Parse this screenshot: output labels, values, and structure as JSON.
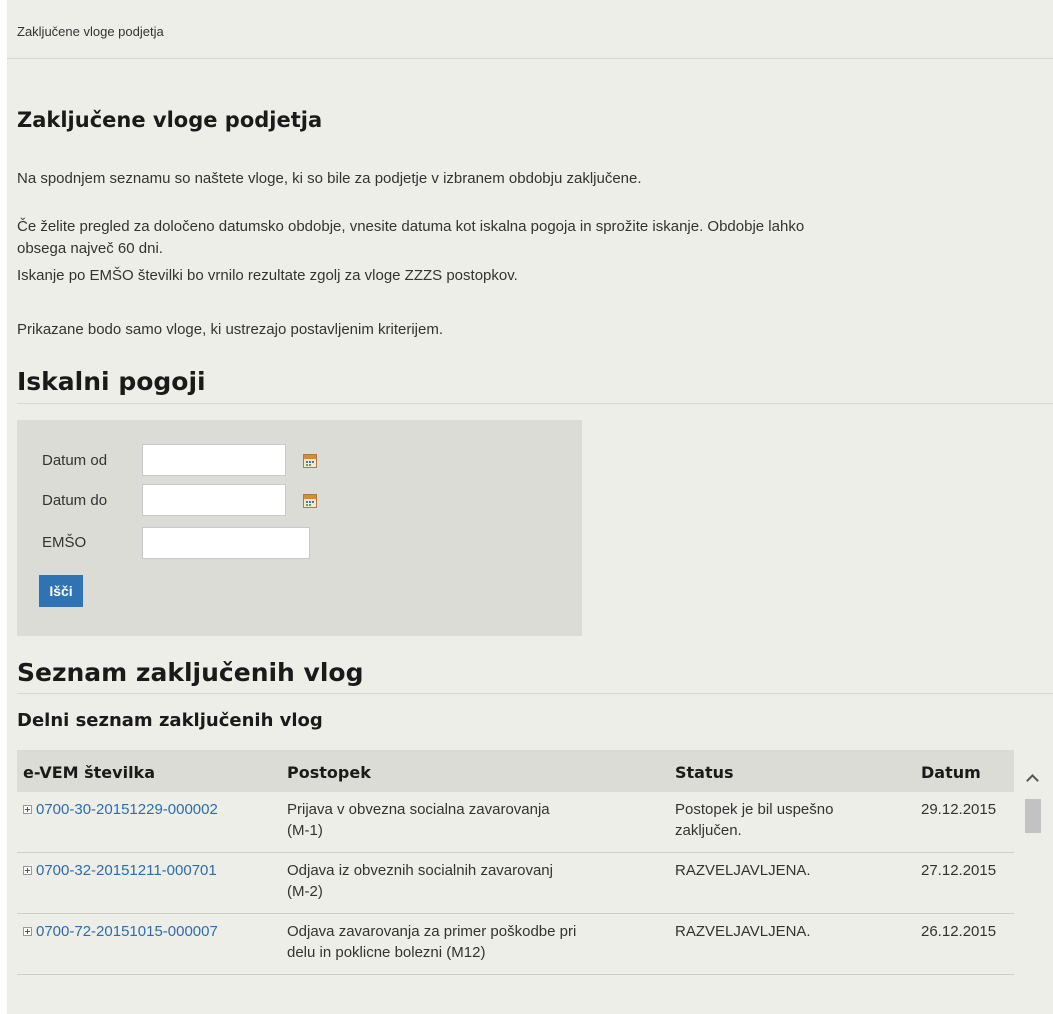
{
  "breadcrumb": "Zaključene vloge podjetja",
  "page_title": "Zaključene vloge podjetja",
  "intro": {
    "p1": "Na spodnjem seznamu so naštete vloge, ki so bile za podjetje v izbranem obdobju zaključene.",
    "p2a": "Če želite pregled za določeno datumsko obdobje, vnesite datuma kot iskalna pogoja in sprožite iskanje. Obdobje lahko",
    "p2b": "obsega največ 60 dni.",
    "p3": "Iskanje po EMŠO številki bo vrnilo rezultate zgolj za vloge ZZZS postopkov.",
    "p4": "Prikazane bodo samo vloge, ki ustrezajo postavljenim kriterijem."
  },
  "search": {
    "heading": "Iskalni pogoji",
    "date_from_label": "Datum od",
    "date_from_value": "",
    "date_to_label": "Datum do",
    "date_to_value": "",
    "emso_label": "EMŠO",
    "emso_value": "",
    "button_label": "Išči",
    "calendar_icon": "calendar-icon"
  },
  "results": {
    "heading": "Seznam zaključenih vlog",
    "subheading": "Delni seznam zaključenih vlog",
    "columns": [
      "e-VEM številka",
      "Postopek",
      "Status",
      "Datum"
    ],
    "rows": [
      {
        "number": "0700-30-20151229-000002",
        "procedure_l1": "Prijava v obvezna socialna zavarovanja",
        "procedure_l2": "(M-1)",
        "status_l1": "Postopek je bil uspešno",
        "status_l2": "zaključen.",
        "date": "29.12.2015"
      },
      {
        "number": "0700-32-20151211-000701",
        "procedure_l1": "Odjava iz obveznih socialnih zavarovanj",
        "procedure_l2": "(M-2)",
        "status_l1": "RAZVELJAVLJENA.",
        "status_l2": "",
        "date": "27.12.2015"
      },
      {
        "number": "0700-72-20151015-000007",
        "procedure_l1": "Odjava zavarovanja za primer poškodbe pri",
        "procedure_l2": "delu in poklicne bolezni (M12)",
        "status_l1": "RAZVELJAVLJENA.",
        "status_l2": "",
        "date": "26.12.2015"
      }
    ]
  },
  "colors": {
    "page_bg": "#eeeee8",
    "panel_bg": "#dcdcd6",
    "link": "#2a6db0",
    "button": "#2f73b5"
  }
}
